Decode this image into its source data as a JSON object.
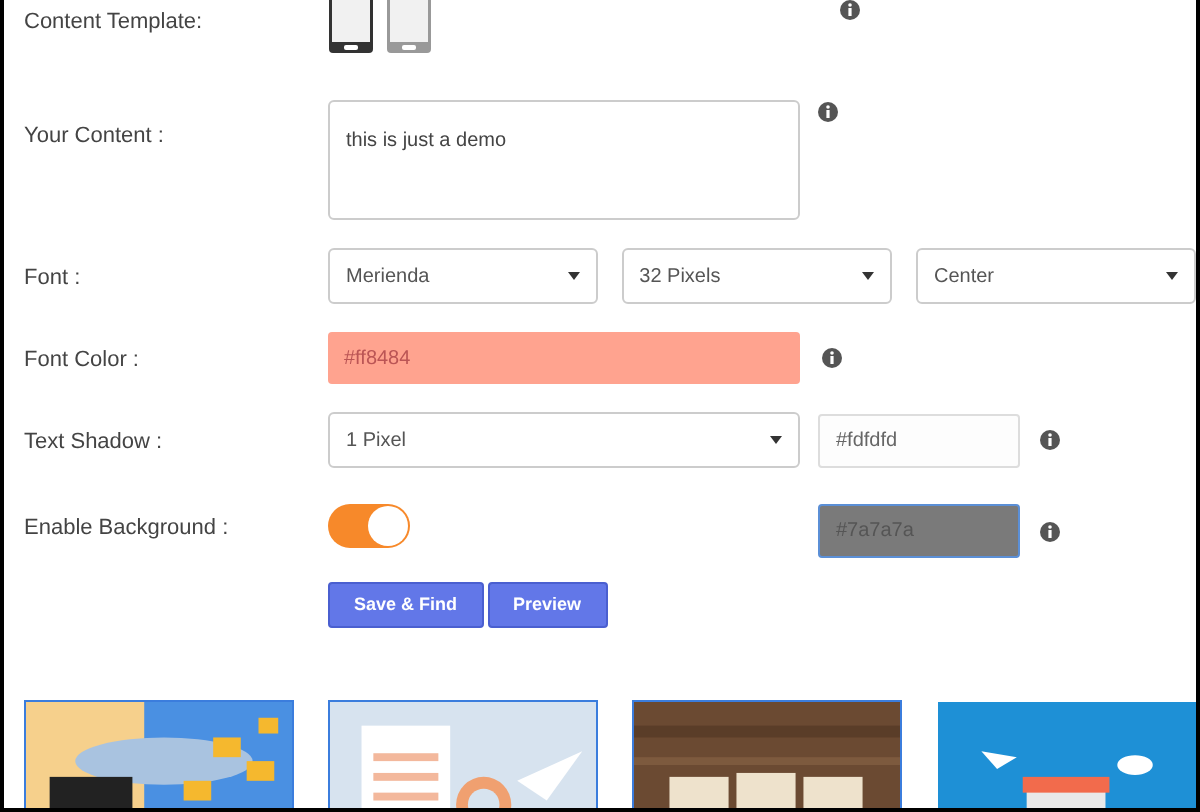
{
  "template_row": {
    "label": "Content Template:",
    "templates": [
      {
        "selected": true
      },
      {
        "selected": false
      }
    ]
  },
  "content_row": {
    "label": "Your Content :",
    "value": "this is just a demo"
  },
  "font_row": {
    "label": "Font :",
    "font": "Merienda",
    "size": "32 Pixels",
    "align": "Center"
  },
  "font_color_row": {
    "label": "Font Color :",
    "value": "#ff8484",
    "color": "#ffa38f"
  },
  "text_shadow_row": {
    "label": "Text Shadow :",
    "size": "1 Pixel",
    "color_value": "#fdfdfd"
  },
  "background_row": {
    "label": "Enable Background :",
    "on": true,
    "color_value": "#7a7a7a",
    "color": "#7a7a7a"
  },
  "buttons": [
    "Save & Find",
    "Preview"
  ],
  "thumbnails": [
    {
      "kind": "picture",
      "selected": true
    },
    {
      "kind": "picture",
      "selected": true
    },
    {
      "kind": "picture",
      "selected": true
    },
    {
      "kind": "picture",
      "selected": false
    }
  ]
}
